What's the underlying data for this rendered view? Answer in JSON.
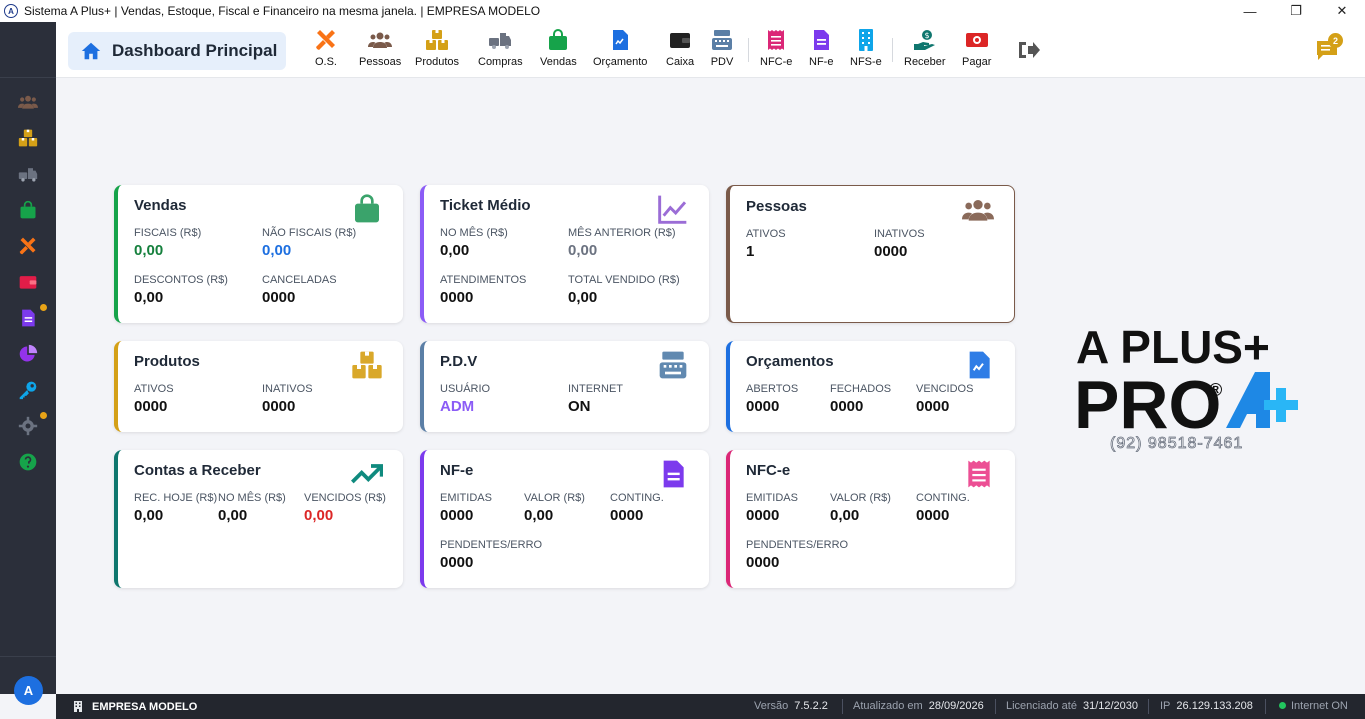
{
  "window": {
    "title": "Sistema A Plus+ | Vendas, Estoque, Fiscal e Financeiro na mesma janela. | EMPRESA MODELO",
    "app_icon_letter": "A",
    "minimize": "—",
    "maximize": "❐",
    "close": "✕"
  },
  "sidebar": {
    "items": [
      {
        "icon": "people-icon",
        "color": "#7a5a4a"
      },
      {
        "icon": "boxes-icon",
        "color": "#d4a017"
      },
      {
        "icon": "truck-icon",
        "color": "#6b7280"
      },
      {
        "icon": "shopping-bag-icon",
        "color": "#16a34a"
      },
      {
        "icon": "tools-icon",
        "color": "#f97316"
      },
      {
        "icon": "wallet-icon",
        "color": "#e11d48"
      },
      {
        "icon": "document-icon",
        "color": "#7c3aed",
        "dot": true
      },
      {
        "icon": "pie-chart-icon",
        "color": "#9333ea"
      },
      {
        "icon": "key-icon",
        "color": "#0ea5e9"
      },
      {
        "icon": "gear-icon",
        "color": "#6b7280",
        "dot": true
      },
      {
        "icon": "help-icon",
        "color": "#16a34a"
      }
    ],
    "avatar_letter": "A"
  },
  "toolbar": {
    "dashboard_label": "Dashboard Principal",
    "items": [
      {
        "label": "O.S.",
        "icon": "tools-icon",
        "color": "#f97316"
      },
      {
        "label": "Pessoas",
        "icon": "people-icon",
        "color": "#7a5a4a"
      },
      {
        "label": "Produtos",
        "icon": "boxes-icon",
        "color": "#d4a017"
      },
      {
        "label": "Compras",
        "icon": "truck-icon",
        "color": "#6b7280"
      },
      {
        "label": "Vendas",
        "icon": "shopping-bag-icon",
        "color": "#16a34a"
      },
      {
        "label": "Orçamento",
        "icon": "document-icon",
        "color": "#1d6fe0"
      },
      {
        "label": "Caixa",
        "icon": "wallet-icon",
        "color": "#222222"
      },
      {
        "label": "PDV",
        "icon": "cash-register-icon",
        "color": "#5b7fa6"
      },
      {
        "label": "NFC-e",
        "icon": "receipt-icon",
        "color": "#db2777"
      },
      {
        "label": "NF-e",
        "icon": "invoice-icon",
        "color": "#7c3aed"
      },
      {
        "label": "NFS-e",
        "icon": "building-icon",
        "color": "#0ea5e9"
      },
      {
        "label": "Receber",
        "icon": "hand-money-icon",
        "color": "#0f766e"
      },
      {
        "label": "Pagar",
        "icon": "money-icon",
        "color": "#dc2626"
      }
    ],
    "notification_count": "2"
  },
  "cards": {
    "vendas": {
      "title": "Vendas",
      "fields": [
        {
          "label": "FISCAIS (R$)",
          "value": "0,00",
          "color": "#15803d"
        },
        {
          "label": "NÃO FISCAIS (R$)",
          "value": "0,00",
          "color": "#1d6fe0"
        },
        {
          "label": "DESCONTOS (R$)",
          "value": "0,00"
        },
        {
          "label": "CANCELADAS",
          "value": "0000"
        }
      ]
    },
    "ticket": {
      "title": "Ticket Médio",
      "fields": [
        {
          "label": "NO MÊS (R$)",
          "value": "0,00"
        },
        {
          "label": "MÊS ANTERIOR (R$)",
          "value": "0,00",
          "color": "#6b7280"
        },
        {
          "label": "ATENDIMENTOS",
          "value": "0000"
        },
        {
          "label": "TOTAL VENDIDO (R$)",
          "value": "0,00"
        }
      ]
    },
    "pessoas": {
      "title": "Pessoas",
      "fields": [
        {
          "label": "ATIVOS",
          "value": "1"
        },
        {
          "label": "INATIVOS",
          "value": "0000"
        }
      ]
    },
    "produtos": {
      "title": "Produtos",
      "fields": [
        {
          "label": "ATIVOS",
          "value": "0000"
        },
        {
          "label": "INATIVOS",
          "value": "0000"
        }
      ]
    },
    "pdv": {
      "title": "P.D.V",
      "fields": [
        {
          "label": "USUÁRIO",
          "value": "ADM",
          "color": "#8b5cf6"
        },
        {
          "label": "INTERNET",
          "value": "ON"
        }
      ]
    },
    "orcamentos": {
      "title": "Orçamentos",
      "fields": [
        {
          "label": "ABERTOS",
          "value": "0000"
        },
        {
          "label": "FECHADOS",
          "value": "0000"
        },
        {
          "label": "VENCIDOS",
          "value": "0000"
        }
      ]
    },
    "receber": {
      "title": "Contas a Receber",
      "fields": [
        {
          "label": "REC. HOJE (R$)",
          "value": "0,00"
        },
        {
          "label": "NO MÊS (R$)",
          "value": "0,00"
        },
        {
          "label": "VENCIDOS (R$)",
          "value": "0,00",
          "color": "#dc2626"
        }
      ]
    },
    "nfe": {
      "title": "NF-e",
      "fields": [
        {
          "label": "EMITIDAS",
          "value": "0000"
        },
        {
          "label": "VALOR (R$)",
          "value": "0,00"
        },
        {
          "label": "CONTING.",
          "value": "0000"
        },
        {
          "label": "PENDENTES/ERRO",
          "value": "0000"
        }
      ]
    },
    "nfce": {
      "title": "NFC-e",
      "fields": [
        {
          "label": "EMITIDAS",
          "value": "0000"
        },
        {
          "label": "VALOR (R$)",
          "value": "0,00"
        },
        {
          "label": "CONTING.",
          "value": "0000"
        },
        {
          "label": "PENDENTES/ERRO",
          "value": "0000"
        }
      ]
    }
  },
  "brand": {
    "line1": "A PLUS+",
    "line2": "PRO",
    "registered": "®",
    "phone": "(92) 98518-7461"
  },
  "statusbar": {
    "company": "EMPRESA MODELO",
    "version_label": "Versão",
    "version": "7.5.2.2",
    "updated_label": "Atualizado em",
    "updated": "28/09/2026",
    "licensed_label": "Licenciado até",
    "licensed": "31/12/2030",
    "ip_label": "IP",
    "ip": "26.129.133.208",
    "internet": "Internet ON"
  }
}
